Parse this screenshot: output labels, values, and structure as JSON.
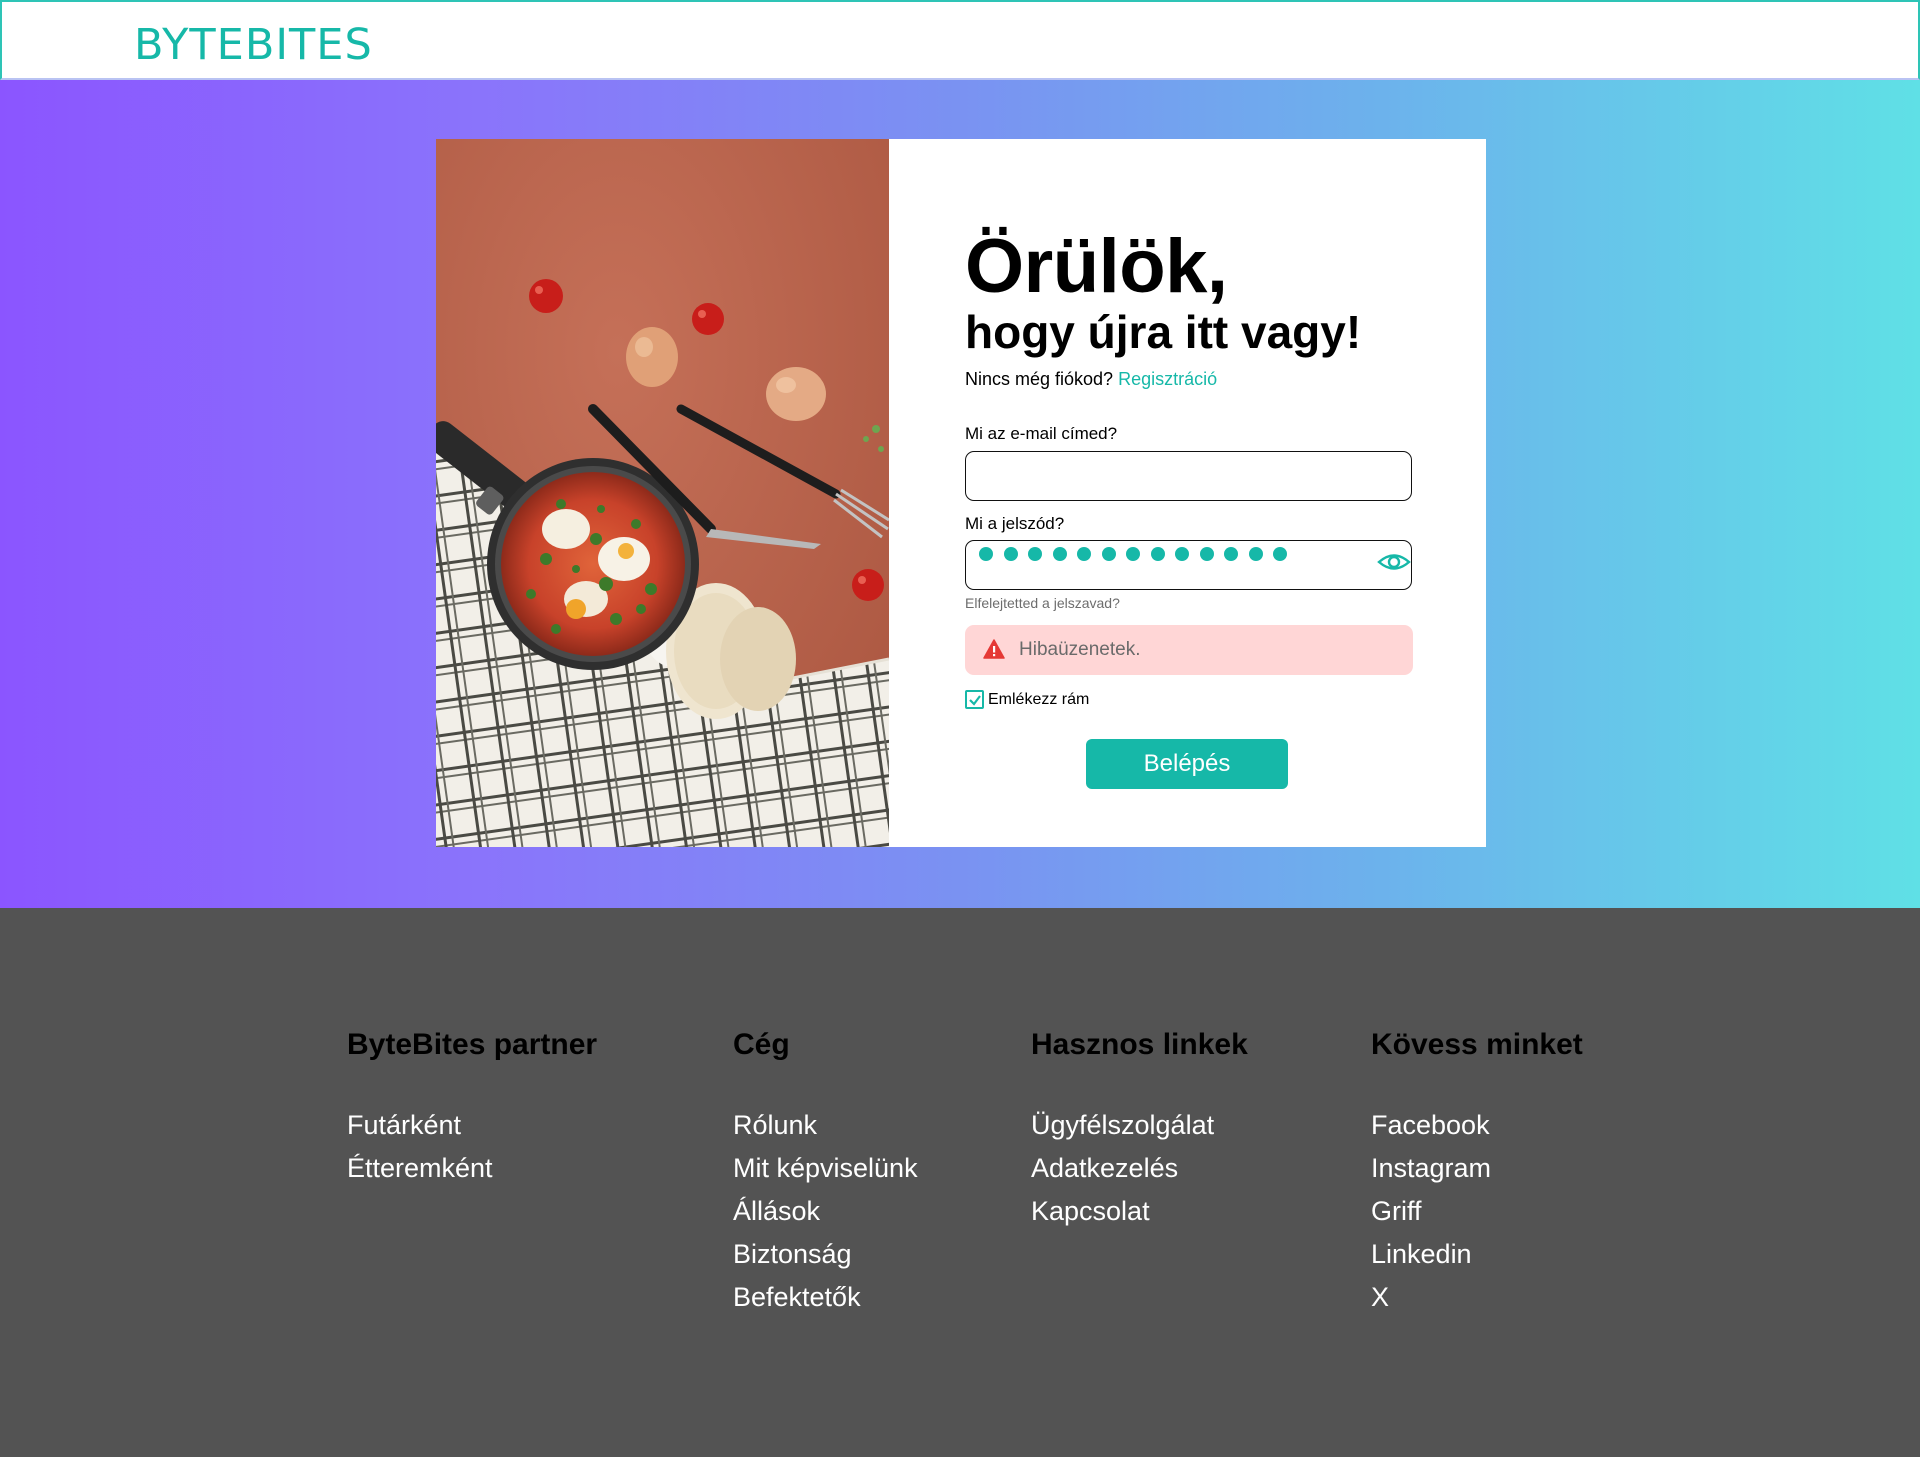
{
  "header": {
    "brand": "BYTEBITES"
  },
  "login": {
    "title": "Örülök,",
    "subtitle": "hogy újra itt vagy!",
    "no_account_text": "Nincs még fiókod?",
    "register_link": "Regisztráció",
    "email_label": "Mi az e-mail címed?",
    "email_value": "",
    "password_label": "Mi a jelszód?",
    "password_masked_count": 13,
    "forgot_password": "Elfelejtetted a jelszavad?",
    "error_message": "Hibaüzenetek.",
    "remember_me": "Emlékezz rám",
    "remember_checked": true,
    "submit": "Belépés"
  },
  "footer": {
    "columns": [
      {
        "title": "ByteBites partner",
        "links": [
          "Futárként",
          "Étteremként"
        ]
      },
      {
        "title": "Cég",
        "links": [
          "Rólunk",
          "Mit képviselünk",
          "Állások",
          "Biztonság",
          "Befektetők"
        ]
      },
      {
        "title": "Hasznos linkek",
        "links": [
          "Ügyfélszolgálat",
          "Adatkezelés",
          "Kapcsolat"
        ]
      },
      {
        "title": "Kövess minket",
        "links": [
          "Facebook",
          "Instagram",
          "Griff",
          "Linkedin",
          "X"
        ]
      }
    ]
  },
  "colors": {
    "accent": "#16b8a8",
    "gradient_start": "#8b55ff",
    "gradient_end": "#5fe0e6",
    "footer_bg": "#535353",
    "error_bg": "#ffd6d6",
    "error_icon": "#e53935"
  },
  "icons": {
    "password_toggle": "eye-icon",
    "error": "warning-icon",
    "checkbox": "check-icon"
  }
}
